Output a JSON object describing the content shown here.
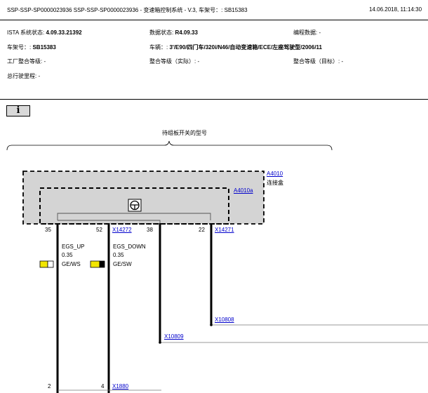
{
  "header": {
    "title": "SSP-SSP-SP0000023936 SSP-SSP-SP0000023936 - 变速箱控制系统 - V.3, 车架号：: SB15383",
    "date": "14.06.2018, 11:14:30"
  },
  "info": {
    "ista_label": "ISTA 系统状态:",
    "ista_value": "4.09.33.21392",
    "data_label": "数据状态:",
    "data_value": "R4.09.33",
    "prog_label": "编程数据: -",
    "vin_label": "车架号：:",
    "vin_value": "SB15383",
    "vehicle_label": "车辆：:",
    "vehicle_value": "3'/E90/四门车/320i/N46/自动变速箱/ECE/左座驾驶型/2006/11",
    "factory_level": "工厂整合等级: -",
    "actual_level": "整合等级（实际）: -",
    "target_level": "整合等级（目标）: -",
    "mileage": "总行驶里程: -"
  },
  "info_button": {
    "label": "i"
  },
  "diagram": {
    "brace_label": "待组板开关的型号",
    "connector_outer": "A4010",
    "connector_outer_desc": "连接盒",
    "connector_inner": "A4010a",
    "pins": {
      "p35": "35",
      "p52": "52",
      "p38": "38",
      "p22": "22",
      "p2": "2",
      "p4": "4"
    },
    "links": {
      "x14272": "X14272",
      "x14271": "X14271",
      "x10808": "X10808",
      "x10809": "X10809",
      "x1880": "X1880"
    },
    "wire1": {
      "name": "EGS_UP",
      "gauge": "0.35",
      "color": "GE/WS",
      "swatch_main": "#f2e600",
      "swatch_stripe": "#ffffff"
    },
    "wire2": {
      "name": "EGS_DOWN",
      "gauge": "0.35",
      "color": "GE/SW",
      "swatch_main": "#f2e600",
      "swatch_stripe": "#000000"
    },
    "box_fill": "#d4d4d4"
  }
}
